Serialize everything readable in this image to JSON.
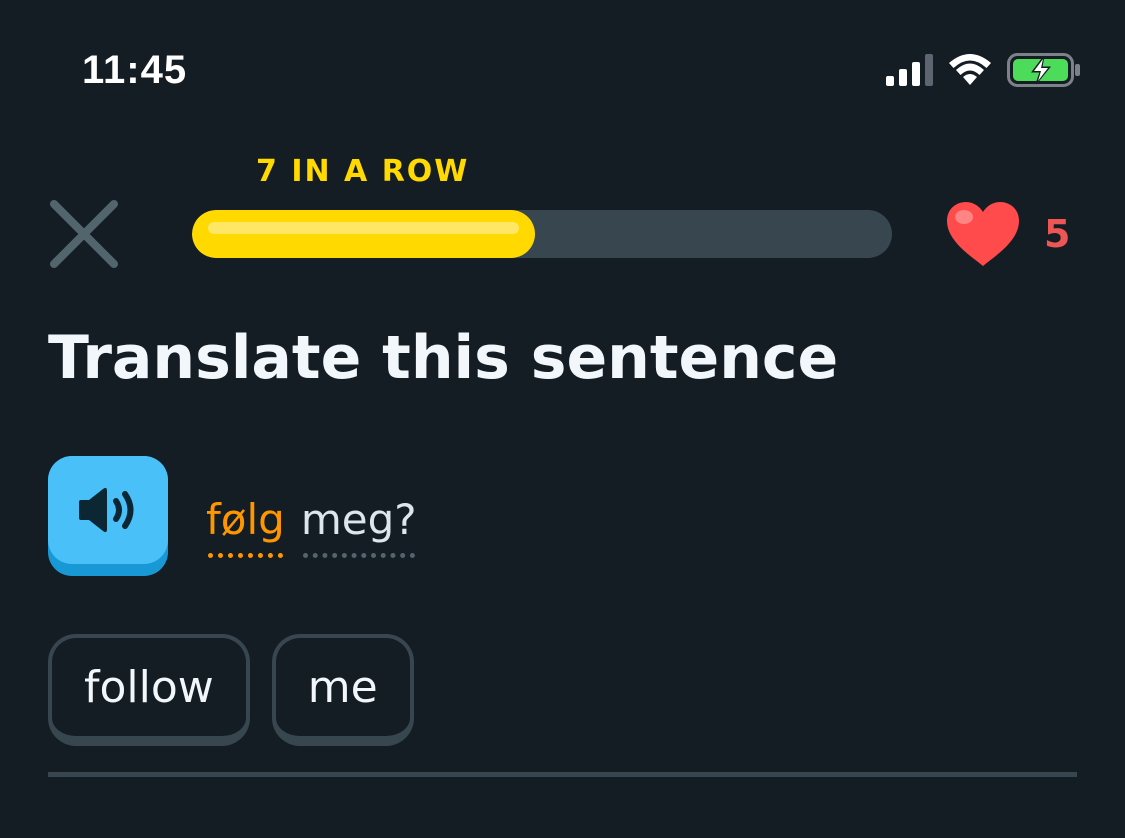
{
  "status_bar": {
    "time": "11:45",
    "signal_bars_active": 3,
    "signal_bars_total": 4,
    "battery_level": 1.0,
    "battery_charging": true
  },
  "lesson": {
    "streak_label": "7 IN A ROW",
    "progress": 0.49,
    "hearts": "5"
  },
  "exercise": {
    "prompt": "Translate this sentence",
    "sentence_words": [
      {
        "text": "følg",
        "status": "new"
      },
      {
        "text": "meg?",
        "status": "known"
      }
    ]
  },
  "answer": {
    "chips": [
      "follow",
      "me"
    ]
  },
  "colors": {
    "background": "#151d24",
    "streak": "#ffd900",
    "heart": "#ee5555",
    "speaker": "#49c0f8",
    "new_word": "#ff9600",
    "battery": "#4ddc5a"
  }
}
